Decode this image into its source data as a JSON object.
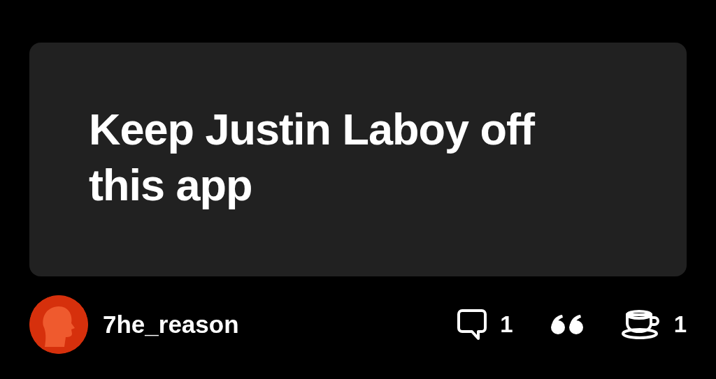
{
  "post": {
    "text": "Keep Justin Laboy off this app"
  },
  "author": {
    "username": "7he_reason"
  },
  "actions": [
    {
      "kind": "comment",
      "count": "1"
    },
    {
      "kind": "quote"
    },
    {
      "kind": "tip",
      "count": "1"
    }
  ]
}
